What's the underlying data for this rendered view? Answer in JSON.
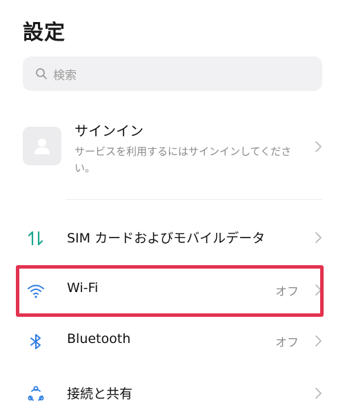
{
  "header": {
    "title": "設定"
  },
  "search": {
    "placeholder": "検索",
    "icon": "search-icon"
  },
  "account": {
    "title": "サインイン",
    "subtitle": "サービスを利用するにはサインインしてください。",
    "icon": "person-icon"
  },
  "settings": [
    {
      "label": "SIM カードおよびモバイルデータ",
      "status": "",
      "icon": "mobile-data-icon"
    },
    {
      "label": "Wi-Fi",
      "status": "オフ",
      "icon": "wifi-icon"
    },
    {
      "label": "Bluetooth",
      "status": "オフ",
      "icon": "bluetooth-icon"
    },
    {
      "label": "接続と共有",
      "status": "",
      "icon": "connection-sharing-icon"
    }
  ],
  "colors": {
    "accent_blue": "#2f7de1",
    "accent_teal": "#1aa88f",
    "highlight_red": "#e2324f"
  }
}
